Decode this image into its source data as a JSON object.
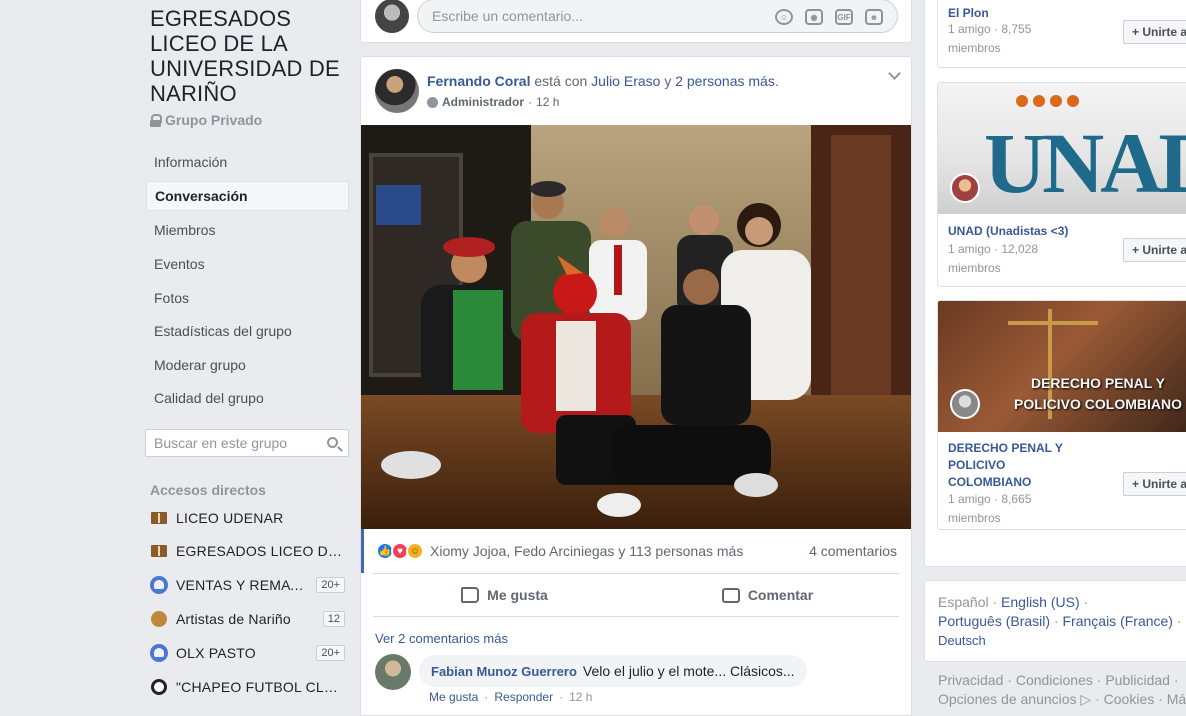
{
  "group": {
    "title": "EGRESADOS LICEO DE LA UNIVERSIDAD DE NARIÑO",
    "privacy": "Grupo Privado"
  },
  "nav": {
    "info": "Información",
    "conversation": "Conversación",
    "members": "Miembros",
    "events": "Eventos",
    "photos": "Fotos",
    "stats": "Estadísticas del grupo",
    "moderate": "Moderar grupo",
    "quality": "Calidad del grupo"
  },
  "search": {
    "placeholder": "Buscar en este grupo"
  },
  "shortcuts": {
    "heading": "Accesos directos",
    "items": [
      {
        "label": "LICEO UDENAR",
        "count": ""
      },
      {
        "label": "EGRESADOS LICEO DE LA UNIVERSIDAD",
        "count": ""
      },
      {
        "label": "VENTAS Y REMATES",
        "count": "20+"
      },
      {
        "label": "Artistas de Nariño",
        "count": "12"
      },
      {
        "label": "OLX PASTO",
        "count": "20+"
      },
      {
        "label": "\"CHAPEO FUTBOL CLUB\"",
        "count": ""
      }
    ]
  },
  "composer": {
    "placeholder": "Escribe un comentario...",
    "gif": "GIF"
  },
  "post": {
    "author": "Fernando Coral",
    "with_text": " está con ",
    "tag1": "Julio Eraso",
    "and_text": " y ",
    "tag2": "2 personas más",
    "dot": ".",
    "role": "Administrador",
    "time": "12 h",
    "reactions_text": "Xiomy Jojoa, Fedo Arciniegas y 113 personas más",
    "comments_count": "4 comentarios",
    "like": "Me gusta",
    "comment": "Comentar",
    "more_comments": "Ver 2 comentarios más",
    "comment1": {
      "author": "Fabian Munoz Guerrero",
      "text": "Velo el julio y el mote... Clásicos...",
      "like": "Me gusta",
      "reply": "Responder",
      "time": "12 h"
    }
  },
  "suggestions": [
    {
      "title": "El Plon",
      "members": "1 amigo · 8,755 miembros",
      "join": "Unirte al grupo"
    },
    {
      "title": "UNAD (Unadistas <3)",
      "members": "1 amigo · 12,028 miembros",
      "join": "Unirte al grupo",
      "banner": "UNAD"
    },
    {
      "title": "DERECHO PENAL Y POLICIVO COLOMBIANO",
      "members": "1 amigo · 8,665 miembros",
      "join": "Unirte al grupo",
      "banner_line1": "DERECHO PENAL Y",
      "banner_line2": "POLICIVO COLOMBIANO"
    }
  ],
  "languages": {
    "es": "Español",
    "en": "English (US)",
    "pt": "Português (Brasil)",
    "fr": "Français (France)",
    "de": "Deutsch"
  },
  "footer": {
    "privacy": "Privacidad",
    "terms": "Condiciones",
    "ads": "Publicidad",
    "adchoices": "Opciones de anuncios",
    "cookies": "Cookies",
    "more": "Más"
  }
}
